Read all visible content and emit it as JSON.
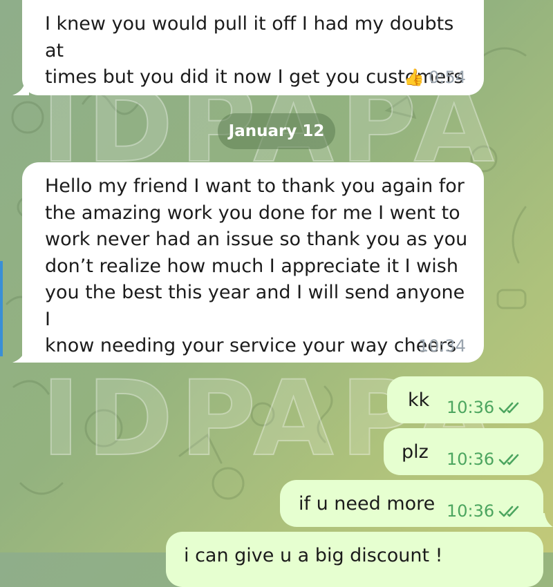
{
  "date_separator": "January 12",
  "watermark_text": "IDPAPA",
  "messages": [
    {
      "direction": "incoming",
      "text_lines": [
        "I knew you would pull it off I had my doubts at",
        "times but you did it now I get you customers"
      ],
      "reaction_icon": "thumbs-up",
      "reaction_emoji": "👍",
      "time": "0:54"
    },
    {
      "direction": "incoming",
      "text_lines": [
        "Hello my friend I want to thank you again for",
        "the amazing work you done for me I went to",
        "work never had an issue so thank you as you",
        "don’t realize how much I appreciate it I wish",
        "you the best this year and I will send anyone I",
        "know needing your service your way cheers"
      ],
      "time": "10:34"
    },
    {
      "direction": "outgoing",
      "text": "kk",
      "time": "10:36",
      "status": "read"
    },
    {
      "direction": "outgoing",
      "text": "plz",
      "time": "10:36",
      "status": "read"
    },
    {
      "direction": "outgoing",
      "text": "if u need more",
      "time": "10:36",
      "status": "read"
    },
    {
      "direction": "outgoing",
      "text": "i can give u a big discount !",
      "time": "",
      "status": ""
    }
  ],
  "colors": {
    "incoming_bubble": "#ffffff",
    "outgoing_bubble": "#e6ffd0",
    "outgoing_meta": "#4ca55f",
    "incoming_meta": "#9aa4ae",
    "date_pill": "#5c7e52"
  }
}
